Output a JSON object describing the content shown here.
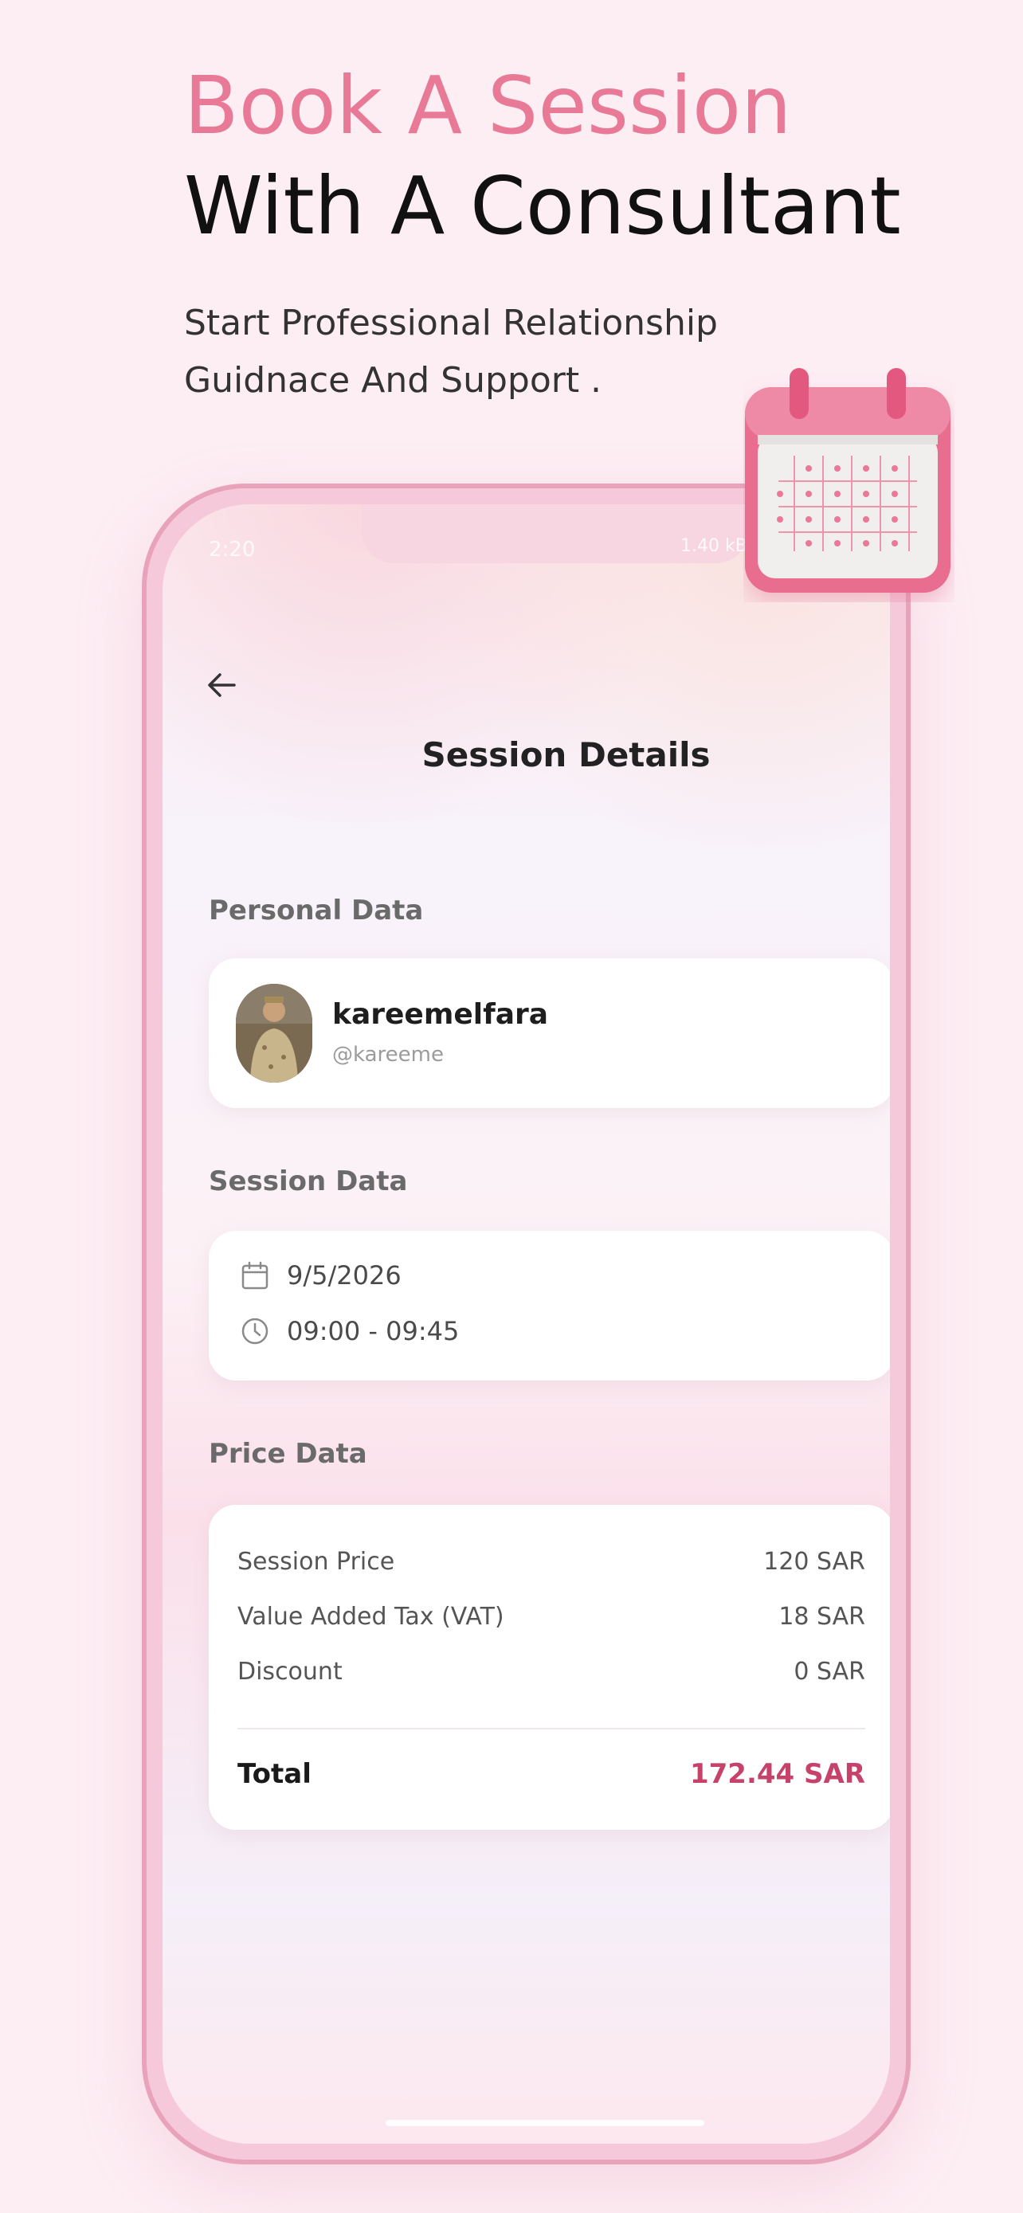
{
  "hero": {
    "title_line1": "Book A Session",
    "title_line2": "With A Consultant",
    "subtitle_line1": "Start Professional Relationship",
    "subtitle_line2": "Guidnace And Support ."
  },
  "status_bar": {
    "time": "2:20",
    "network": "1.40 kB/s"
  },
  "header": {
    "title": "Session Details"
  },
  "personal": {
    "label": "Personal Data",
    "name": "kareemelfara",
    "handle": "@kareeme"
  },
  "session": {
    "label": "Session Data",
    "date": "9/5/2026",
    "time": "09:00 - 09:45"
  },
  "price": {
    "label": "Price Data",
    "rows": [
      {
        "label": "Session Price",
        "value": "120 SAR"
      },
      {
        "label": "Value Added Tax (VAT)",
        "value": "18 SAR"
      },
      {
        "label": "Discount",
        "value": "0 SAR"
      }
    ],
    "total_label": "Total",
    "total_value": "172.44 SAR"
  },
  "colors": {
    "accent": "#e87a98",
    "total": "#c6426a",
    "background": "#fdeef4"
  },
  "icons": {
    "back": "arrow-left-icon",
    "date": "calendar-icon",
    "time": "clock-icon",
    "decoration": "calendar-3d-icon"
  }
}
